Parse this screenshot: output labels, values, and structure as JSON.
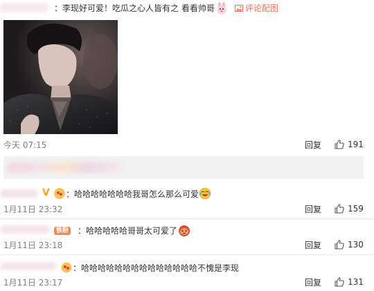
{
  "top_comment": {
    "text": "：李现好可爱！吃瓜之心人皆有之 看看帅哥",
    "rabbit_emoji": "rabbit-emoji",
    "view_image_label": "评论配图",
    "time": "今天 07:15",
    "reply_label": "回复",
    "likes": "191"
  },
  "repost_bar": {
    "colors": [
      "#f6d7dc",
      "#fbe3cf",
      "#ead9e6",
      "#f8e6ec"
    ]
  },
  "replies": [
    {
      "text": "：哈哈哈哈哈哈哈我哥怎么那么可爱",
      "badge": "",
      "time": "1月11日 23:32",
      "reply_label": "回复",
      "likes": "159"
    },
    {
      "text": "：哈哈哈哈哈哥哥太可爱了",
      "badge": "铁粉",
      "time": "1月11日 23:18",
      "reply_label": "回复",
      "likes": "130"
    },
    {
      "text": "：哈哈哈哈哈哈哈哈哈哈哈哈哈哈不愧是李现",
      "badge": "",
      "time": "1月11日 23:17",
      "reply_label": "回复",
      "likes": "131"
    }
  ],
  "colors": {
    "link": "#eb7350",
    "muted": "#808080",
    "divider": "#e6e6e6",
    "badge": "#f08a5d"
  }
}
